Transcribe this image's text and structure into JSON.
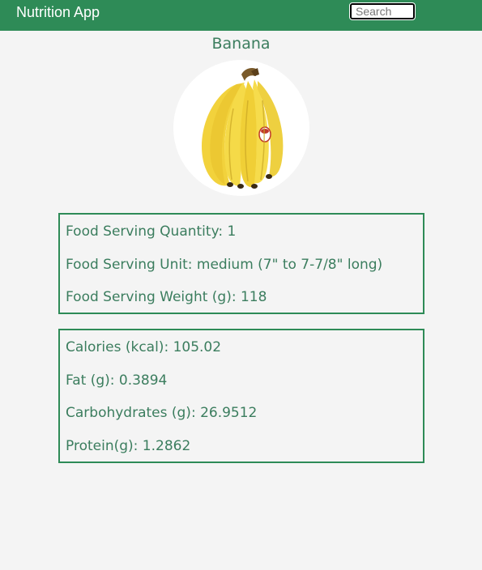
{
  "navbar": {
    "brand": "Nutrition App",
    "search_placeholder": "Search"
  },
  "food": {
    "name": "Banana",
    "image_icon": "banana-icon"
  },
  "serving": {
    "quantity_label": "Food Serving Quantity: 1",
    "unit_label": "Food Serving Unit: medium (7\" to 7-7/8\" long)",
    "weight_label": "Food Serving Weight (g): 118"
  },
  "nutrition": {
    "calories_label": "Calories (kcal): 105.02",
    "fat_label": "Fat (g): 0.3894",
    "carbs_label": "Carbohydrates (g): 26.9512",
    "protein_label": "Protein(g): 1.2862"
  },
  "colors": {
    "brand_green": "#2e8b57",
    "text_green": "#3b7d5e",
    "banana_yellow": "#f2d23c",
    "background": "#f4f4f4"
  }
}
